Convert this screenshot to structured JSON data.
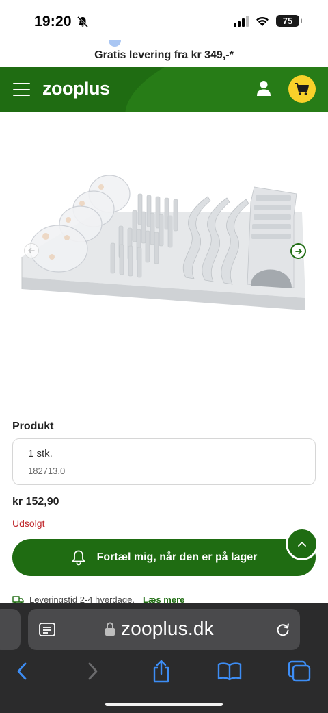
{
  "status_bar": {
    "time": "19:20",
    "battery": "75"
  },
  "promo": {
    "text": "Gratis levering fra kr 349,-*"
  },
  "header": {
    "logo": "zooplus"
  },
  "product": {
    "section_label": "Produkt",
    "variant_name": "1 stk.",
    "variant_sku": "182713.0",
    "price": "kr 152,90",
    "availability": "Udsolgt",
    "notify_label": "Fortæl mig, når den er på lager",
    "delivery_text": "Leveringstid 2-4 hverdage.",
    "delivery_link": "Læs mere"
  },
  "browser": {
    "url": "zooplus.dk"
  },
  "colors": {
    "brand_green": "#1f6c12",
    "cart_yellow": "#f8d12a",
    "sold_out_red": "#c0282d"
  },
  "icons": [
    "bell-slash-icon",
    "signal-icon",
    "wifi-icon",
    "menu-icon",
    "user-icon",
    "cart-icon",
    "arrow-left-icon",
    "arrow-right-icon",
    "bell-icon",
    "chevron-up-icon",
    "truck-icon",
    "reader-icon",
    "lock-icon",
    "reload-icon",
    "back-icon",
    "forward-icon",
    "share-icon",
    "bookmarks-icon",
    "tabs-icon"
  ]
}
